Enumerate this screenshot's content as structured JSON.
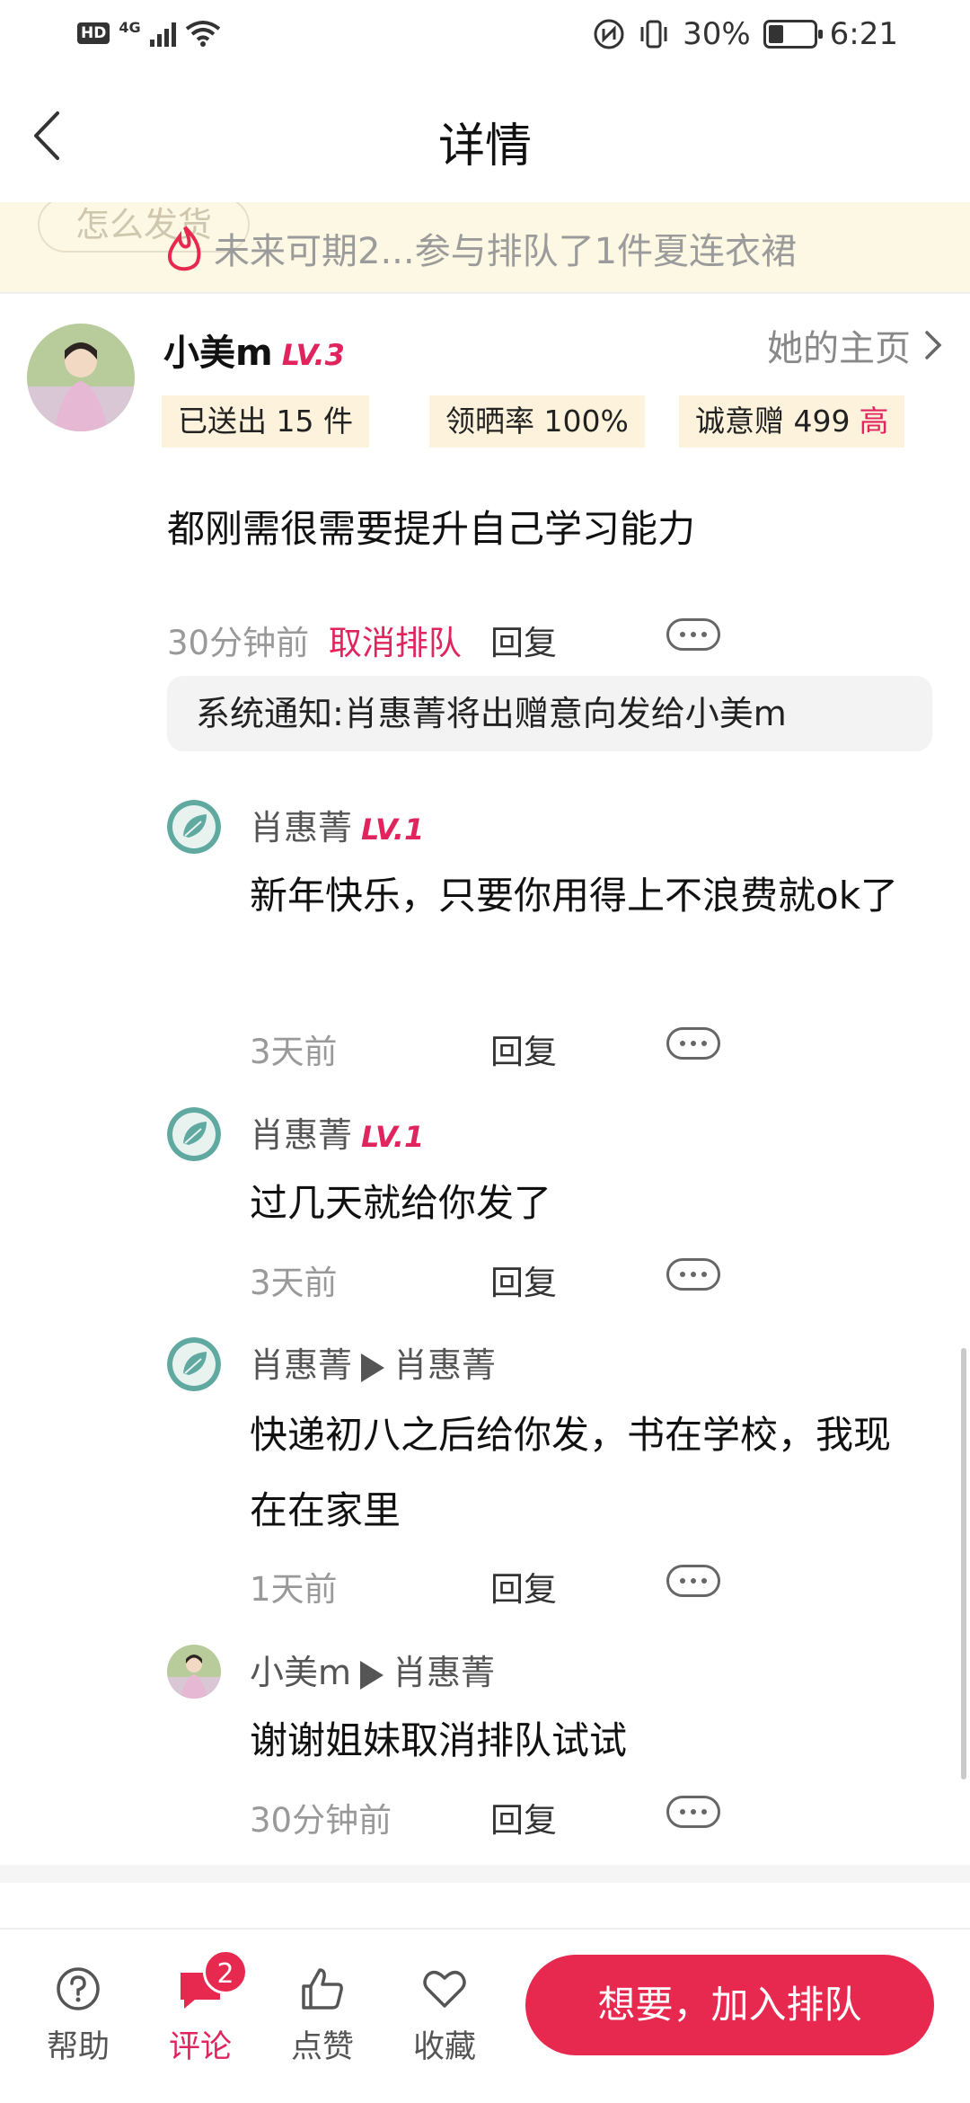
{
  "status_bar": {
    "hd": "HD",
    "network": "4G",
    "battery": "30%",
    "time": "6:21"
  },
  "header": {
    "title": "详情"
  },
  "banner": {
    "pill_label": "怎么发货",
    "text": "未来可期2...参与排队了1件夏连衣裙"
  },
  "post": {
    "username": "小美m",
    "level": "LV.3",
    "homepage_label": "她的主页",
    "stats": [
      {
        "label": "已送出 15 件"
      },
      {
        "label": "领晒率 100%"
      },
      {
        "label": "诚意赠 499",
        "tag": "高"
      }
    ],
    "text": "都刚需很需要提升自己学习能力",
    "time": "30分钟前",
    "cancel_label": "取消排队",
    "reply_label": "回复",
    "system_note": "系统通知:肖惠菁将出赠意向发给小美m"
  },
  "replies": [
    {
      "author": "肖惠菁",
      "level": "LV.1",
      "text": "新年快乐，只要你用得上不浪费就ok了",
      "time": "3天前",
      "reply_label": "回复"
    },
    {
      "author": "肖惠菁",
      "level": "LV.1",
      "text": "过几天就给你发了",
      "time": "3天前",
      "reply_label": "回复"
    },
    {
      "author": "肖惠菁",
      "to": "肖惠菁",
      "text": "快递初八之后给你发，书在学校，我现在在家里",
      "time": "1天前",
      "reply_label": "回复"
    },
    {
      "author": "小美m",
      "to": "肖惠菁",
      "text": "谢谢姐妹取消排队试试",
      "time": "30分钟前",
      "reply_label": "回复"
    }
  ],
  "bottom_bar": {
    "help": "帮助",
    "comment": "评论",
    "comment_badge": "2",
    "like": "点赞",
    "favorite": "收藏",
    "cta": "想要，加入排队"
  },
  "colors": {
    "accent": "#e8294f",
    "level": "#e0245e",
    "banner_bg": "#fdf8e3",
    "chip_bg": "#fdf3dc"
  }
}
